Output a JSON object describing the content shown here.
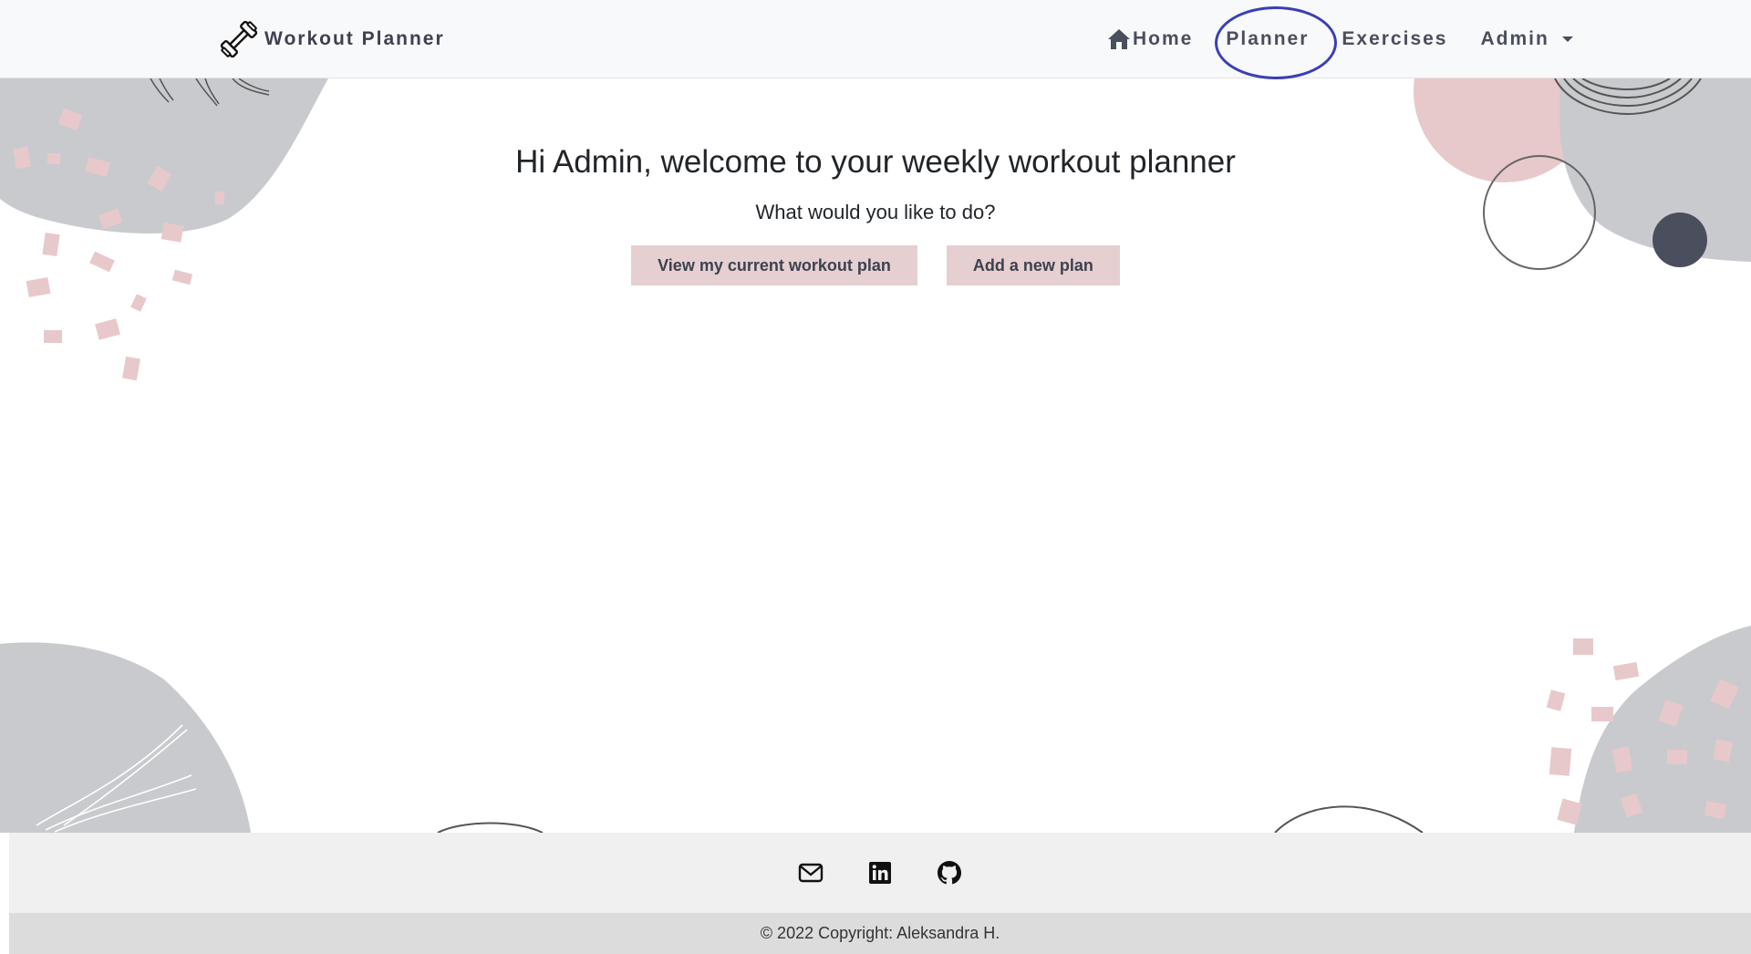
{
  "brand": {
    "name": "Workout Planner",
    "icon": "dumbbell-icon"
  },
  "nav": {
    "home": "Home",
    "planner": "Planner",
    "exercises": "Exercises",
    "admin": "Admin"
  },
  "main": {
    "title": "Hi Admin, welcome to your weekly workout planner",
    "subtitle": "What would you like to do?",
    "view_plan_button": "View my current workout plan",
    "add_plan_button": "Add a new plan"
  },
  "footer": {
    "social_icons": [
      "email-icon",
      "linkedin-icon",
      "github-icon"
    ],
    "copyright": "© 2022 Copyright: Aleksandra H."
  },
  "colors": {
    "button_bg": "#e6cfd0",
    "nav_text": "#4a4e5d",
    "accent_blob_gray": "#c9cace",
    "accent_blob_pink": "#e8c9cb",
    "dark_circle": "#4a4e5d",
    "highlight_ring": "#3b3fb4"
  }
}
